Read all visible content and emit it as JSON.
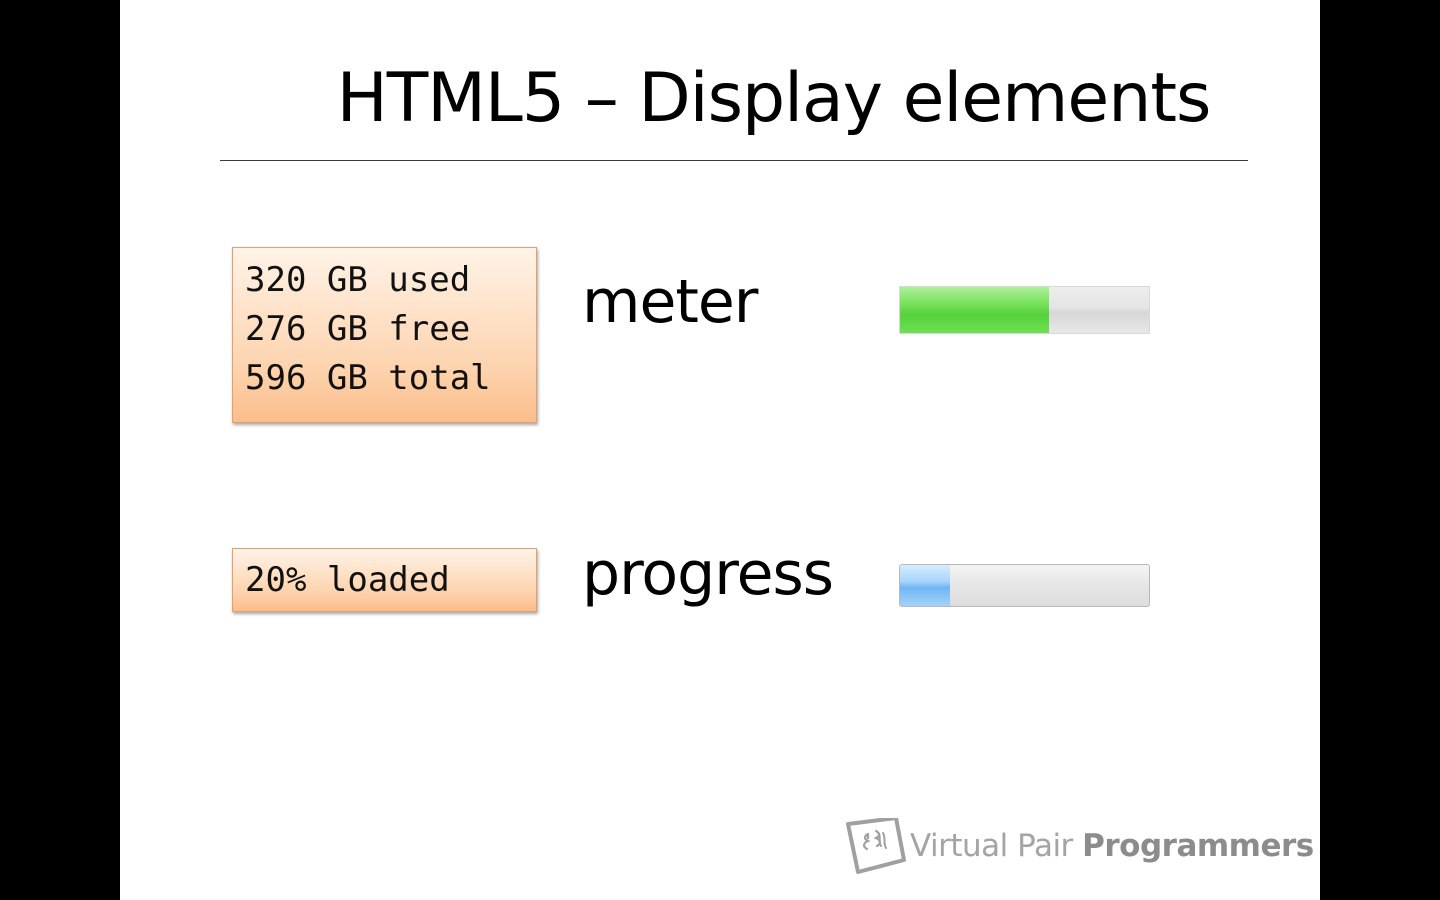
{
  "slide": {
    "title": "HTML5 – Display elements",
    "meter_example": {
      "lines": [
        "320 GB used",
        "276 GB free",
        "596 GB total"
      ],
      "label": "meter",
      "value": 0.6,
      "fill_color": "#6bde4f"
    },
    "progress_example": {
      "lines": [
        "20% loaded"
      ],
      "label": "progress",
      "value": 0.2,
      "fill_color": "#8cc5f7"
    },
    "branding": {
      "logo_icon": "vpp-logo-icon",
      "name_light": "Virtual Pair ",
      "name_bold": "Programmers"
    }
  },
  "colors": {
    "code_box_bg": "#fdd3ad",
    "background": "#ffffff",
    "letterbox": "#000000"
  }
}
